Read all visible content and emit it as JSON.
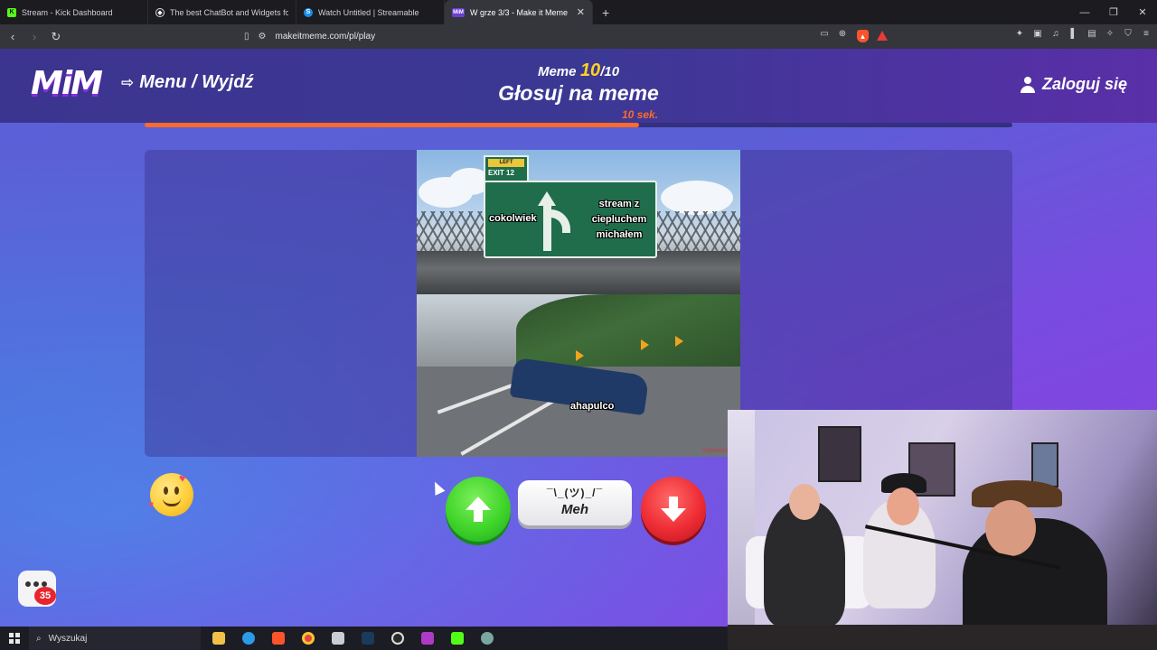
{
  "browser": {
    "tabs": [
      {
        "title": "Stream - Kick Dashboard",
        "favicon": "kick-icon",
        "active": false
      },
      {
        "title": "The best ChatBot and Widgets fo",
        "favicon": "botrix-icon",
        "active": false
      },
      {
        "title": "Watch Untitled | Streamable",
        "favicon": "streamable-icon",
        "active": false
      },
      {
        "title": "W grze 3/3 - Make it Meme",
        "favicon": "mim-icon",
        "active": true
      }
    ],
    "url": "makeitmeme.com/pl/play"
  },
  "header": {
    "logo": "MiM",
    "menu_label": "Menu / Wyjdź",
    "login_label": "Zaloguj się",
    "meme_label": "Meme",
    "meme_current": "10",
    "meme_total": "/10",
    "phase_title": "Głosuj na meme",
    "timer": "10 sek.",
    "progress": 0.57
  },
  "meme": {
    "exit_sign_label": "LEFT",
    "exit_number": "EXIT 12",
    "left_option": "cokolwiek",
    "right_option_line1": "stream z",
    "right_option_line2": "ciepluchem",
    "right_option_line3": "michałem",
    "car_caption": "ahapulco",
    "watermark": "makeitmeme"
  },
  "vote": {
    "meh_shrug": "¯\\_(ツ)_/¯",
    "meh_label": "Meh"
  },
  "chat_widget": {
    "badge_count": "35"
  },
  "taskbar": {
    "search_placeholder": "Wyszukaj"
  },
  "colors": {
    "accent_orange": "#ff6a2a",
    "upvote_green": "#3fd42a",
    "downvote_red": "#ee2c34",
    "counter_yellow": "#ffd21f"
  }
}
